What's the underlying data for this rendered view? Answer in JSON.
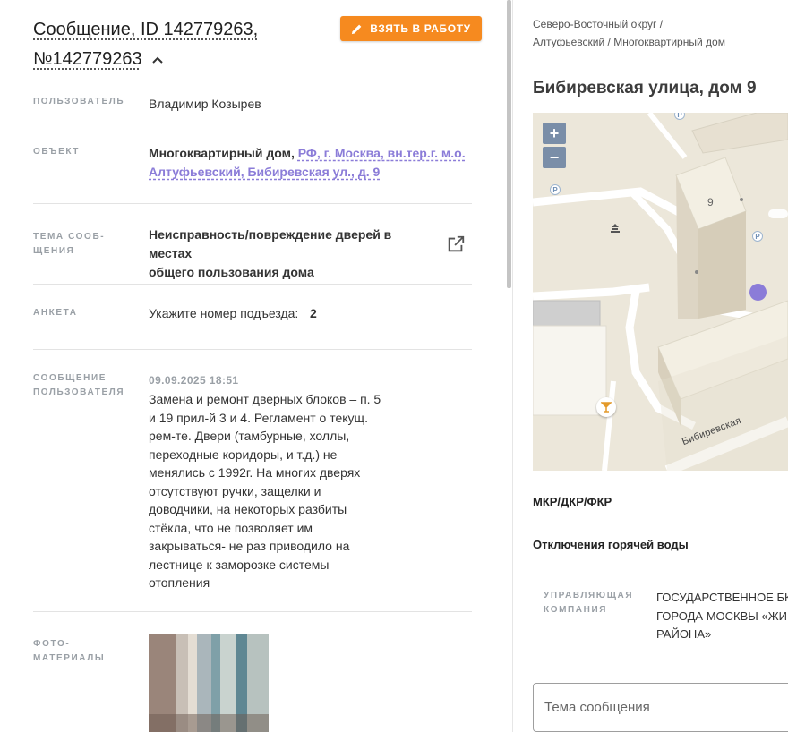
{
  "header": {
    "title_line1": "Сообщение, ID 142779263,",
    "title_line2": "№142779263",
    "action_button": "ВЗЯТЬ В РАБОТУ"
  },
  "fields": {
    "user": {
      "label": "ПОЛЬЗОВАТЕЛЬ",
      "value": "Владимир Козырев"
    },
    "object": {
      "label": "ОБЪЕКТ",
      "type_text": "Многоквартирный дом,",
      "address_line1": "РФ, г. Москва, вн.тер.г. м.о.",
      "address_line2": "Алтуфьевский, Бибиревская ул., д. 9"
    },
    "topic": {
      "label_line1": "ТЕМА СООБ-",
      "label_line2": "ЩЕНИЯ",
      "value_line1": "Неисправность/повреждение дверей в местах",
      "value_line2": "общего пользования дома"
    },
    "survey": {
      "label": "АНКЕТА",
      "question": "Укажите номер подъезда:",
      "answer": "2"
    },
    "message": {
      "label_line1": "СООБЩЕНИЕ",
      "label_line2": "ПОЛЬЗОВАТЕЛЯ",
      "date": "09.09.2025 18:51",
      "lines": [
        "Замена и ремонт дверных блоков – п. 5",
        "и 19 прил-й 3 и 4. Регламент о текущ.",
        "рем-те. Двери (тамбурные, холлы,",
        "переходные коридоры, и т.д.) не",
        "менялись с 1992г. На многих дверях",
        "отсутствуют ручки, защелки и",
        "доводчики, на некоторых разбиты",
        "стёкла, что не позволяет им",
        "закрываться- не раз приводило на",
        "лестнице к заморозке системы",
        "отопления"
      ]
    },
    "photos": {
      "label_line1": "ФОТО-",
      "label_line2": "МАТЕРИАЛЫ"
    }
  },
  "right": {
    "breadcrumb_line1": "Северо-Восточный округ /",
    "breadcrumb_line2": "Алтуфьевский / Многоквартирный дом",
    "address_title": "Бибиревская улица, дом 9",
    "map": {
      "zoom_in": "+",
      "zoom_out": "−",
      "building_number": "9",
      "street_label": "Бибиревская",
      "parking": "P"
    },
    "section_mkr": "МКР/ДКР/ФКР",
    "section_hot_water": "Отключения горячей воды",
    "management": {
      "label_line1": "УПРАВЛЯЮЩАЯ",
      "label_line2": "КОМПАНИЯ",
      "value_line1": "ГОСУДАРСТВЕННОЕ БК",
      "value_line2": "ГОРОДА МОСКВЫ «ЖИ",
      "value_line3": "РАЙОНА»"
    },
    "subject_placeholder": "Тема сообщения"
  },
  "colors": {
    "accent_orange": "#f68a1f",
    "link_purple": "#8b7cd8",
    "map_marker": "#8b7cd8",
    "zoom_button": "#7a8ea8"
  },
  "icons": [
    "chevron-up-icon",
    "pencil-icon",
    "open-in-new-icon",
    "parking-icon",
    "bar-icon",
    "marker-icon"
  ]
}
